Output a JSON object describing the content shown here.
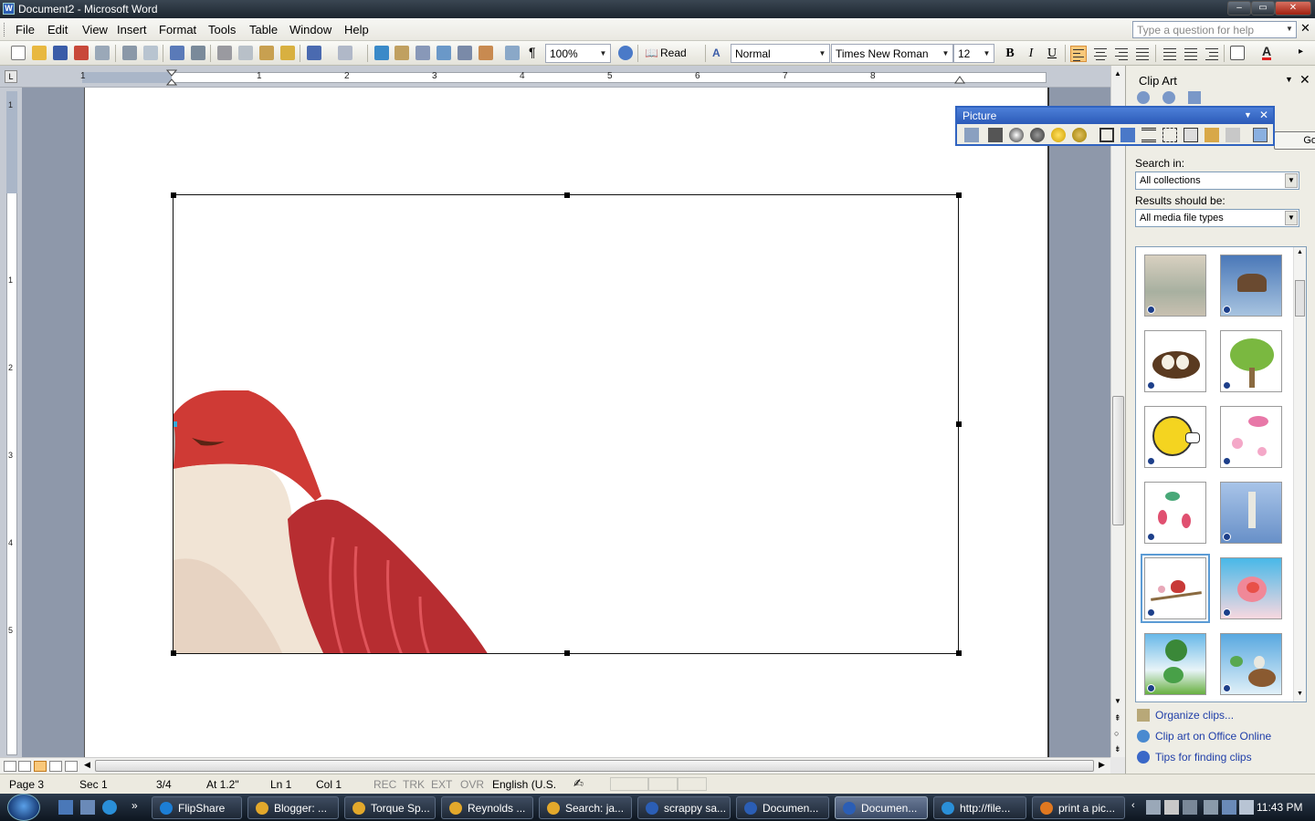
{
  "window": {
    "title": "Document2 - Microsoft Word"
  },
  "menu": {
    "items": [
      "File",
      "Edit",
      "View",
      "Insert",
      "Format",
      "Tools",
      "Table",
      "Window",
      "Help"
    ],
    "help_placeholder": "Type a question for help"
  },
  "toolbar": {
    "zoom": "100%",
    "read_label": "Read",
    "style": "Normal",
    "font": "Times New Roman",
    "size": "12",
    "bold": "B",
    "italic": "I",
    "underline": "U"
  },
  "ruler": {
    "h_numbers": [
      "1",
      "1",
      "2",
      "3",
      "4",
      "5",
      "6",
      "7",
      "8"
    ],
    "v_numbers": [
      "1",
      "1",
      "2",
      "3",
      "4",
      "5"
    ]
  },
  "task_pane": {
    "title": "Clip Art",
    "search_in_label": "Search in:",
    "search_in_value": "All collections",
    "results_label": "Results should be:",
    "results_value": "All media file types",
    "go_label": "Go",
    "links": [
      "Organize clips...",
      "Clip art on Office Online",
      "Tips for finding clips"
    ],
    "thumbnails": [
      "bird-on-beach",
      "flying-hawk",
      "nest-with-eggs",
      "green-tree",
      "singing-bee",
      "pink-birds-flowers",
      "hummingbird-flowers",
      "heron",
      "bird-on-branch",
      "bird-in-heart",
      "birds-in-tree",
      "birds-on-nest"
    ],
    "selected_thumbnail": "bird-on-branch"
  },
  "picture_toolbar": {
    "title": "Picture"
  },
  "status": {
    "page": "Page 3",
    "sec": "Sec 1",
    "of": "3/4",
    "at": "At 1.2\"",
    "ln": "Ln 1",
    "col": "Col 1",
    "rec": "REC",
    "trk": "TRK",
    "ext": "EXT",
    "ovr": "OVR",
    "language": "English (U.S."
  },
  "taskbar": {
    "items": [
      {
        "label": "FlipShare",
        "icon": "flipshare-icon",
        "color": "#1c7ed6"
      },
      {
        "label": "Blogger: ...",
        "icon": "chrome-icon",
        "color": "#e3a82b"
      },
      {
        "label": "Torque Sp...",
        "icon": "chrome-icon",
        "color": "#e3a82b"
      },
      {
        "label": "Reynolds ...",
        "icon": "chrome-icon",
        "color": "#e3a82b"
      },
      {
        "label": "Search: ja...",
        "icon": "chrome-icon",
        "color": "#e3a82b"
      },
      {
        "label": "scrappy sa...",
        "icon": "word-icon",
        "color": "#2b5eb5"
      },
      {
        "label": "Documen...",
        "icon": "word-icon",
        "color": "#2b5eb5"
      },
      {
        "label": "Documen...",
        "icon": "word-icon",
        "color": "#2b5eb5"
      },
      {
        "label": "http://file...",
        "icon": "ie-icon",
        "color": "#2a8fd8"
      },
      {
        "label": "print a pic...",
        "icon": "firefox-icon",
        "color": "#e07820"
      }
    ],
    "active_index": 7,
    "clock": "11:43 PM"
  }
}
